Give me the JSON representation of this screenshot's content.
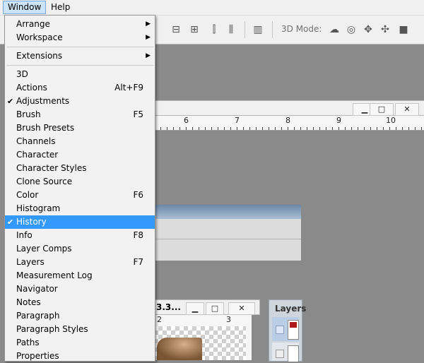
{
  "menubar": {
    "window_label": "Window",
    "help_label": "Help"
  },
  "options_bar": {
    "mode_label": "3D Mode:",
    "icons": [
      "align-icon",
      "align-center-icon",
      "distribute-icon",
      "distribute-h-icon",
      "distribute-v-icon",
      "auto-align-icon",
      "rotate-3d-icon",
      "roll-3d-icon",
      "drag-3d-icon",
      "slide-3d-icon",
      "scale-3d-icon"
    ]
  },
  "main_doc": {
    "minimize": "▁",
    "maximize": "□",
    "close": "✕",
    "ruler_labels": [
      "6",
      "7",
      "8",
      "9",
      "10"
    ]
  },
  "sub_doc": {
    "title_fragment": "3.3...",
    "minimize": "▁",
    "maximize": "□",
    "close": "✕",
    "ruler_labels": [
      "2",
      "3"
    ]
  },
  "layers_panel": {
    "title": "Layers"
  },
  "window_menu": {
    "group1": [
      {
        "label": "Arrange",
        "submenu": true
      },
      {
        "label": "Workspace",
        "submenu": true
      }
    ],
    "group2": [
      {
        "label": "Extensions",
        "submenu": true
      }
    ],
    "group3": [
      {
        "label": "3D",
        "shortcut": ""
      },
      {
        "label": "Actions",
        "shortcut": "Alt+F9"
      },
      {
        "label": "Adjustments",
        "shortcut": "",
        "checked": true
      },
      {
        "label": "Brush",
        "shortcut": "F5"
      },
      {
        "label": "Brush Presets",
        "shortcut": ""
      },
      {
        "label": "Channels",
        "shortcut": ""
      },
      {
        "label": "Character",
        "shortcut": ""
      },
      {
        "label": "Character Styles",
        "shortcut": ""
      },
      {
        "label": "Clone Source",
        "shortcut": ""
      },
      {
        "label": "Color",
        "shortcut": "F6"
      },
      {
        "label": "Histogram",
        "shortcut": ""
      },
      {
        "label": "History",
        "shortcut": "",
        "checked": true,
        "highlighted": true
      },
      {
        "label": "Info",
        "shortcut": "F8"
      },
      {
        "label": "Layer Comps",
        "shortcut": ""
      },
      {
        "label": "Layers",
        "shortcut": "F7"
      },
      {
        "label": "Measurement Log",
        "shortcut": ""
      },
      {
        "label": "Navigator",
        "shortcut": ""
      },
      {
        "label": "Notes",
        "shortcut": ""
      },
      {
        "label": "Paragraph",
        "shortcut": ""
      },
      {
        "label": "Paragraph Styles",
        "shortcut": ""
      },
      {
        "label": "Paths",
        "shortcut": ""
      },
      {
        "label": "Properties",
        "shortcut": ""
      }
    ],
    "glyphs": {
      "check": "✔",
      "submenu_arrow": "▶"
    },
    "colors": {
      "highlight": "#3399ff"
    }
  }
}
